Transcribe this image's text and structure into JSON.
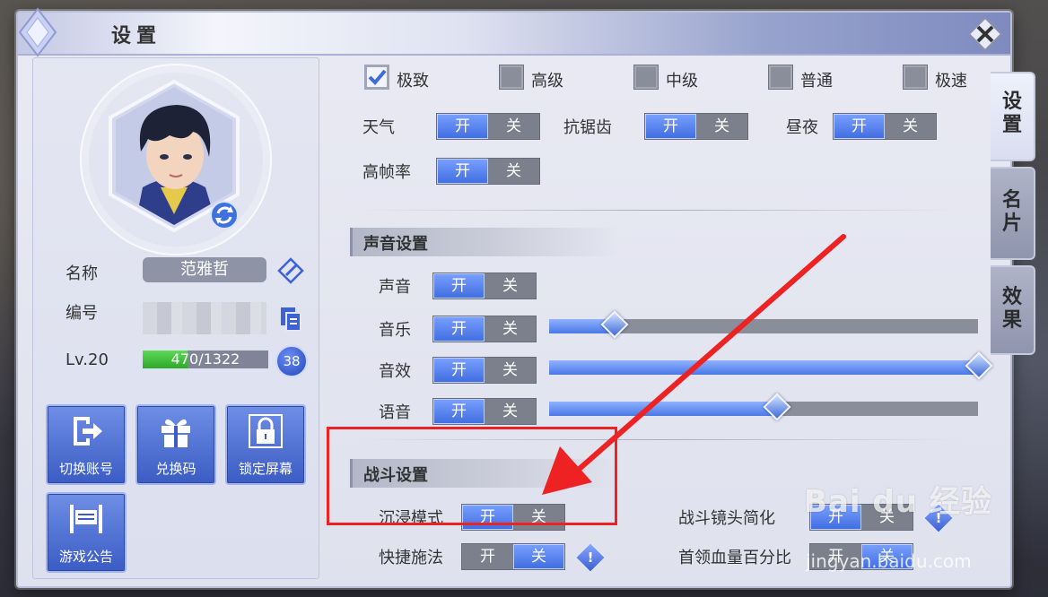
{
  "window": {
    "title": "设置"
  },
  "profile": {
    "name_label": "名称",
    "name_value": "范雅哲",
    "id_label": "编号",
    "level_label": "Lv.20",
    "xp_text": "470/1322",
    "xp_fraction": 0.356,
    "level_badge": "38"
  },
  "actions": [
    {
      "label": "切换账号",
      "icon": "logout-icon"
    },
    {
      "label": "兑换码",
      "icon": "gift-icon"
    },
    {
      "label": "锁定屏幕",
      "icon": "lock-icon"
    },
    {
      "label": "游戏公告",
      "icon": "notice-board-icon"
    }
  ],
  "quality": {
    "options": [
      {
        "label": "极致",
        "checked": true
      },
      {
        "label": "高级",
        "checked": false
      },
      {
        "label": "中级",
        "checked": false
      },
      {
        "label": "普通",
        "checked": false
      },
      {
        "label": "极速",
        "checked": false
      }
    ]
  },
  "toggle_words": {
    "on": "开",
    "off": "关"
  },
  "graphics": {
    "weather": {
      "label": "天气",
      "state": "on"
    },
    "antialias": {
      "label": "抗锯齿",
      "state": "on"
    },
    "daynight": {
      "label": "昼夜",
      "state": "on"
    },
    "highfps": {
      "label": "高帧率",
      "state": "on"
    }
  },
  "sound": {
    "header": "声音设置",
    "sound": {
      "label": "声音",
      "state": "on"
    },
    "music": {
      "label": "音乐",
      "state": "on",
      "level": 0.15
    },
    "sfx": {
      "label": "音效",
      "state": "on",
      "level": 1.0
    },
    "voice": {
      "label": "语音",
      "state": "on",
      "level": 0.53
    }
  },
  "battle": {
    "header": "战斗设置",
    "immersive": {
      "label": "沉浸模式",
      "state": "on"
    },
    "camera": {
      "label": "战斗镜头简化",
      "state": "on"
    },
    "quickcast": {
      "label": "快捷施法",
      "state": "off"
    },
    "bosshp": {
      "label": "首领血量百分比",
      "state": "off"
    }
  },
  "tabs": [
    {
      "label": "设置",
      "chars": [
        "设",
        "置"
      ],
      "active": true
    },
    {
      "label": "名片",
      "chars": [
        "名",
        "片"
      ],
      "active": false
    },
    {
      "label": "效果",
      "chars": [
        "效",
        "果"
      ],
      "active": false
    }
  ],
  "watermark": {
    "brand": "Bai du 经验",
    "url": "jingyan.baidu.com"
  },
  "colors": {
    "accent": "#4a78e6",
    "annotation": "#ee2222",
    "toggle_off": "#7c808d"
  }
}
